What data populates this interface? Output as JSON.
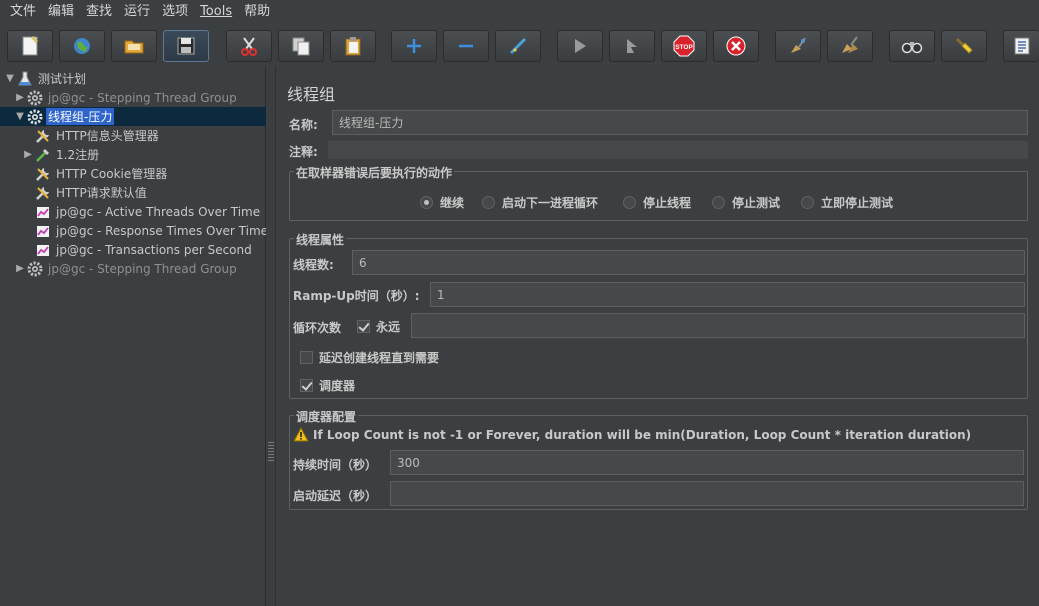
{
  "menu": [
    "文件",
    "编辑",
    "查找",
    "运行",
    "选项",
    "Tools",
    "帮助"
  ],
  "toolbar": {
    "buttons": [
      "new-icon",
      "templates-icon",
      "open-icon",
      "save-icon",
      "cut-icon",
      "copy-icon",
      "paste-icon",
      "expand-icon",
      "collapse-icon",
      "toggle-icon",
      "start-icon",
      "start-no-pause-icon",
      "stop-icon",
      "shutdown-icon",
      "clear-icon",
      "clear-all-icon",
      "search-icon",
      "reset-search-icon",
      "function-helper-icon"
    ]
  },
  "tree": {
    "root": "测试计划",
    "items": [
      {
        "label": "jp@gc - Stepping Thread Group",
        "disabled": true
      },
      {
        "label": "线程组-压力",
        "selected": true
      },
      {
        "label": "HTTP信息头管理器"
      },
      {
        "label": "1.2注册"
      },
      {
        "label": "HTTP Cookie管理器"
      },
      {
        "label": "HTTP请求默认值"
      },
      {
        "label": "jp@gc - Active Threads Over Time"
      },
      {
        "label": "jp@gc - Response Times Over Time"
      },
      {
        "label": "jp@gc - Transactions per Second"
      },
      {
        "label": "jp@gc - Stepping Thread Group",
        "disabled": true
      }
    ]
  },
  "panel": {
    "title": "线程组",
    "name_label": "名称:",
    "name_value": "线程组-压力",
    "comment_label": "注释:",
    "comment_value": "",
    "error_group": {
      "title": "在取样器错误后要执行的动作",
      "options": [
        "继续",
        "启动下一进程循环",
        "停止线程",
        "停止测试",
        "立即停止测试"
      ],
      "selected": "继续"
    },
    "thread_group": {
      "title": "线程属性",
      "threads_label": "线程数:",
      "threads_value": "6",
      "rampup_label": "Ramp-Up时间（秒）:",
      "rampup_value": "1",
      "loop_label": "循环次数",
      "forever_label": "永远",
      "forever_checked": true,
      "loop_value": "",
      "delay_label": "延迟创建线程直到需要",
      "delay_checked": false,
      "scheduler_label": "调度器",
      "scheduler_checked": true
    },
    "scheduler_group": {
      "title": "调度器配置",
      "warning": "If Loop Count is not -1 or Forever, duration will be min(Duration, Loop Count * iteration duration)",
      "duration_label": "持续时间（秒）",
      "duration_value": "300",
      "delay_label": "启动延迟（秒）",
      "delay_value": ""
    }
  },
  "colors": {
    "background": "#3c3f41",
    "selection": "#2f65ca",
    "field": "#45494a",
    "stop_red": "#d9232c"
  }
}
